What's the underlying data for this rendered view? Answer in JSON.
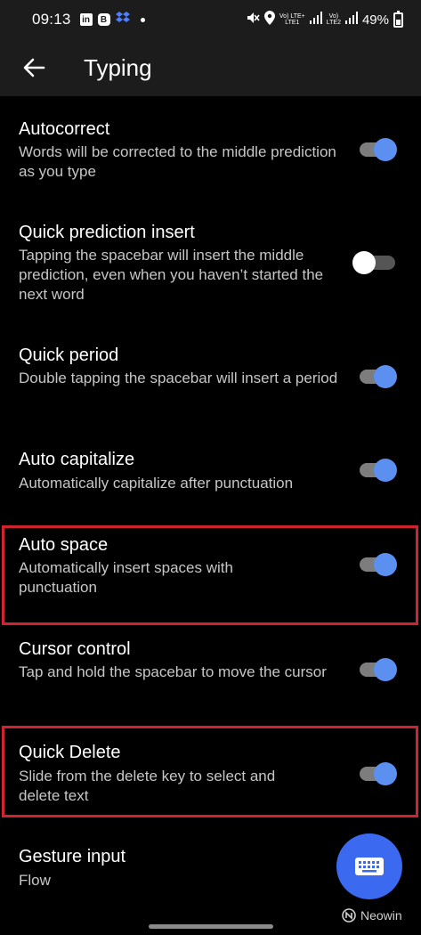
{
  "status_bar": {
    "time": "09:13",
    "app_icons": [
      "linkedin-icon",
      "b-icon",
      "dropbox-icon"
    ],
    "lte1_label": "Vo) LTE+\nLTE1",
    "lte2_label": "Vo)\nLTE2",
    "battery": "49%"
  },
  "app_bar": {
    "title": "Typing"
  },
  "settings": [
    {
      "title": "Autocorrect",
      "description": "Words will be corrected to the middle prediction as you type",
      "enabled": true
    },
    {
      "title": "Quick prediction insert",
      "description": "Tapping the spacebar will insert the middle prediction, even when you haven’t started the next word",
      "enabled": false
    },
    {
      "title": "Quick period",
      "description": "Double tapping the spacebar will insert a period",
      "enabled": true
    },
    {
      "title": "Auto capitalize",
      "description": "Automatically capitalize after punctuation",
      "enabled": true
    },
    {
      "title": "Auto space",
      "description": "Automatically insert spaces with punctuation",
      "enabled": true
    },
    {
      "title": "Cursor control",
      "description": "Tap and hold the spacebar to move the cursor",
      "enabled": true
    },
    {
      "title": "Quick Delete",
      "description": "Slide from the delete key to select and delete text",
      "enabled": true
    },
    {
      "title": "Gesture input",
      "description": "Flow"
    }
  ],
  "fab": {
    "icon": "keyboard-icon"
  },
  "watermark": {
    "text": "Neowin"
  },
  "colors": {
    "toggle_on": "#5b8ff0",
    "highlight": "#d0222f",
    "fab": "#3b6af0"
  }
}
